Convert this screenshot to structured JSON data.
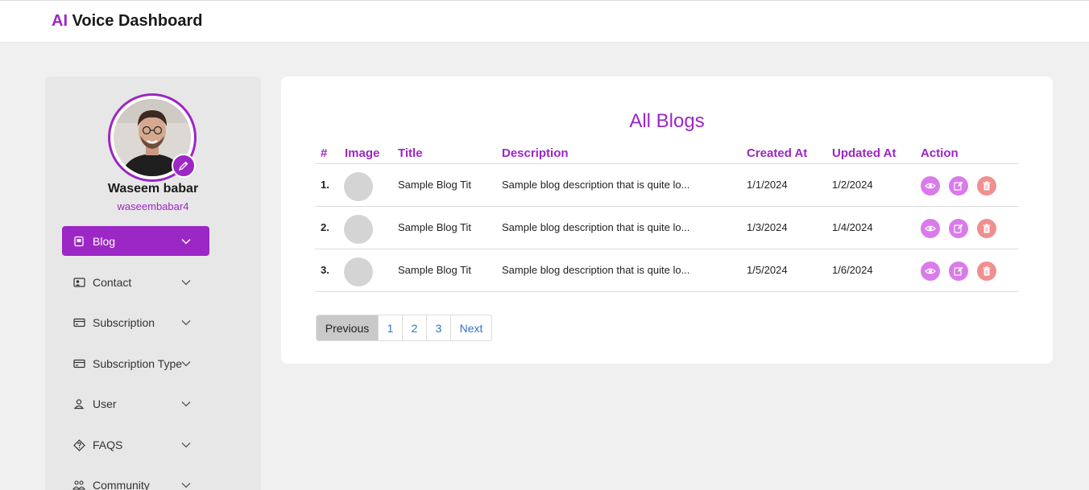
{
  "brand": {
    "accent": "AI",
    "rest": " Voice Dashboard"
  },
  "profile": {
    "name": "Waseem babar",
    "handle": "waseembabar4"
  },
  "nav": [
    {
      "label": "Blog",
      "icon": "blog-icon",
      "active": true
    },
    {
      "label": "Contact",
      "icon": "contact-icon"
    },
    {
      "label": "Subscription",
      "icon": "card-icon"
    },
    {
      "label": "Subscription Type",
      "icon": "card-icon"
    },
    {
      "label": "User",
      "icon": "user-icon"
    },
    {
      "label": "FAQS",
      "icon": "question-icon"
    },
    {
      "label": "Community",
      "icon": "community-icon"
    }
  ],
  "main": {
    "title": "All Blogs",
    "columns": [
      "#",
      "Image",
      "Title",
      "Description",
      "Created At",
      "Updated At",
      "Action"
    ],
    "rows": [
      {
        "num": "1.",
        "title": "Sample Blog Tit",
        "description": "Sample blog description that is quite lo...",
        "created": "1/1/2024",
        "updated": "1/2/2024"
      },
      {
        "num": "2.",
        "title": "Sample Blog Tit",
        "description": "Sample blog description that is quite lo...",
        "created": "1/3/2024",
        "updated": "1/4/2024"
      },
      {
        "num": "3.",
        "title": "Sample Blog Tit",
        "description": "Sample blog description that is quite lo...",
        "created": "1/5/2024",
        "updated": "1/6/2024"
      }
    ],
    "pagination": {
      "prev": "Previous",
      "pages": [
        "1",
        "2",
        "3"
      ],
      "next": "Next"
    }
  },
  "colors": {
    "accent": "#9b27c4",
    "action_view": "#d97bea",
    "action_delete": "#f08f8f",
    "background": "#f0f0f0"
  }
}
